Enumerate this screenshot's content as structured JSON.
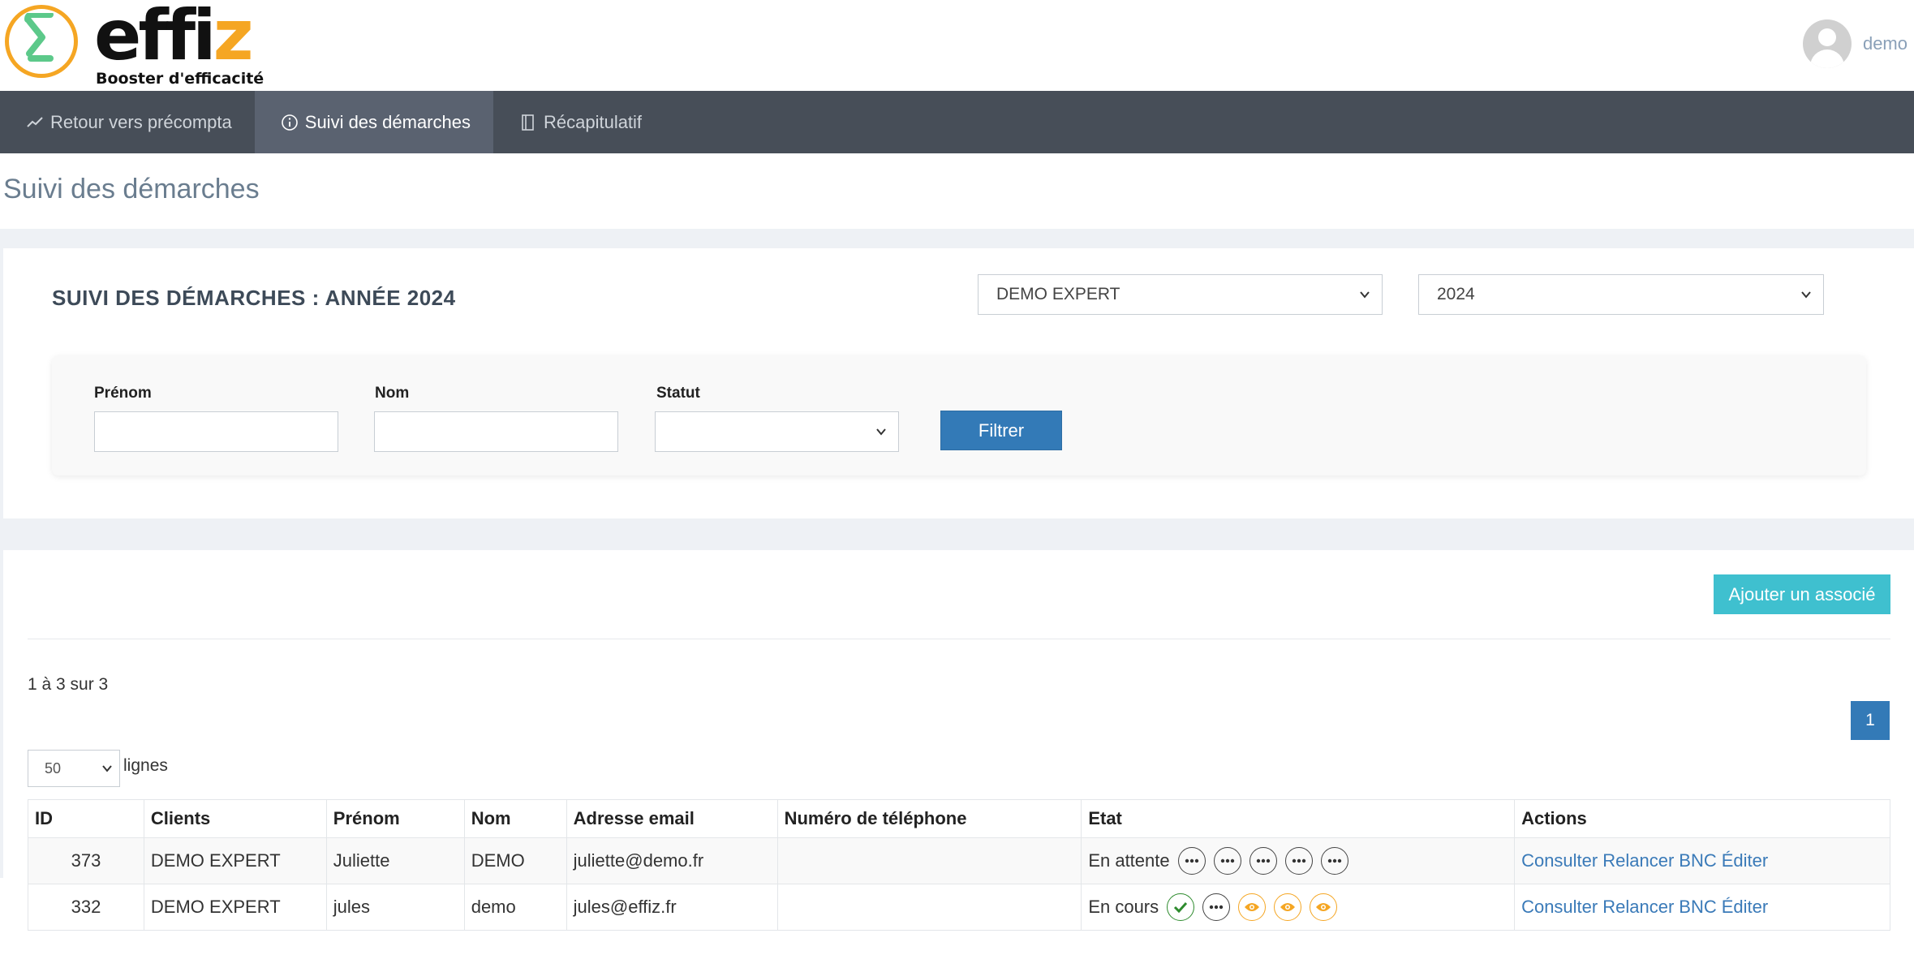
{
  "brand": {
    "name_main": "effi",
    "name_accent": "z",
    "tagline": "Booster d'efficacité"
  },
  "user": {
    "name": "demo"
  },
  "nav": [
    {
      "label": "Retour vers précompta",
      "icon": "chart-line-icon",
      "active": false
    },
    {
      "label": "Suivi des démarches",
      "icon": "info-circle-icon",
      "active": true
    },
    {
      "label": "Récapitulatif",
      "icon": "notebook-icon",
      "active": false
    }
  ],
  "page": {
    "title": "Suivi des démarches"
  },
  "header_card": {
    "title": "SUIVI DES DÉMARCHES : ANNÉE 2024",
    "client_select": "DEMO EXPERT",
    "year_select": "2024"
  },
  "filters": {
    "prenom_label": "Prénom",
    "nom_label": "Nom",
    "statut_label": "Statut",
    "prenom_value": "",
    "nom_value": "",
    "statut_value": "",
    "submit_label": "Filtrer"
  },
  "list": {
    "add_label": "Ajouter un associé",
    "range_text": "1 à 3 sur 3",
    "page_number": "1",
    "rows_per_page": "50",
    "rows_label": "lignes",
    "columns": [
      "ID",
      "Clients",
      "Prénom",
      "Nom",
      "Adresse email",
      "Numéro de téléphone",
      "Etat",
      "Actions"
    ],
    "rows": [
      {
        "id": "373",
        "client": "DEMO EXPERT",
        "prenom": "Juliette",
        "nom": "DEMO",
        "email": "juliette@demo.fr",
        "phone": "",
        "etat": "En attente",
        "steps": [
          "pending",
          "pending",
          "pending",
          "pending",
          "pending"
        ],
        "actions": [
          "Consulter",
          "Relancer",
          "BNC",
          "Éditer"
        ]
      },
      {
        "id": "332",
        "client": "DEMO EXPERT",
        "prenom": "jules",
        "nom": "demo",
        "email": "jules@effiz.fr",
        "phone": "",
        "etat": "En cours",
        "steps": [
          "done",
          "pending",
          "view",
          "view",
          "view"
        ],
        "actions": [
          "Consulter",
          "Relancer",
          "BNC",
          "Éditer"
        ]
      }
    ]
  },
  "colors": {
    "navbar": "#474e58",
    "primary": "#337ab7",
    "add_button": "#3fc0cf",
    "accent": "#f5a623",
    "logo_green": "#5cc98a",
    "success": "#2e8b2e"
  }
}
